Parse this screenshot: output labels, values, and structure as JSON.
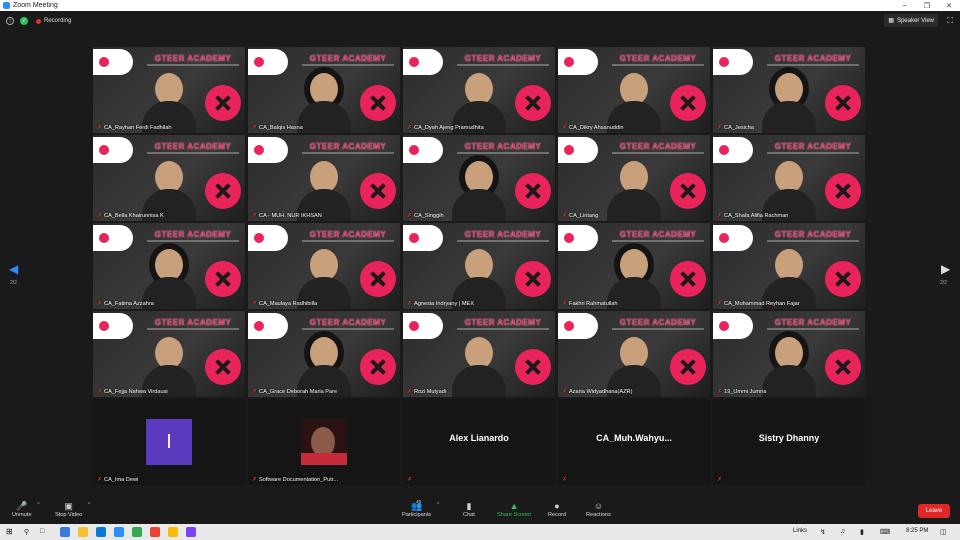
{
  "window": {
    "title": "Zoom Meeting"
  },
  "infobar": {
    "recording_label": "Recording",
    "speaker_view_label": "Speaker View"
  },
  "colors": {
    "brand": "#e8245b",
    "zoom_blue": "#2d8cff",
    "share_green": "#2fc35b",
    "leave_red": "#e02828"
  },
  "brand_text": "GTEER ACADEMY",
  "pagination": {
    "left_label": "2/2",
    "right_label": "2/2"
  },
  "participants": [
    {
      "name": "CA_Rayhan Ferdi Fadhilah",
      "type": "video",
      "muted": true
    },
    {
      "name": "CA_Balqis Hasna",
      "type": "video",
      "muted": true
    },
    {
      "name": "CA_Dyah Ajeng Pramudhita",
      "type": "video",
      "muted": true
    },
    {
      "name": "CA_Dikry Ahsanuddin",
      "type": "video",
      "muted": true
    },
    {
      "name": "CA_Jesicha",
      "type": "video",
      "muted": true
    },
    {
      "name": "CA_Bella Khairunnisa K",
      "type": "video",
      "muted": true
    },
    {
      "name": "CA - MUH. NUR IKHSAN",
      "type": "video",
      "muted": true
    },
    {
      "name": "CA_Singgih",
      "type": "video",
      "muted": true
    },
    {
      "name": "CA_Lintang",
      "type": "video",
      "muted": true
    },
    {
      "name": "CA_Shafa Alifia Rachman",
      "type": "video",
      "muted": true
    },
    {
      "name": "CA_Fatima Azzahra",
      "type": "video",
      "muted": true
    },
    {
      "name": "CA_Maulaya Radhibilla",
      "type": "video",
      "muted": true
    },
    {
      "name": "Agnesia Indryany | MEX",
      "type": "video",
      "muted": true
    },
    {
      "name": "Fakhri Rahmatullah",
      "type": "video",
      "muted": true
    },
    {
      "name": "CA_Muhammad Reyhan Fajar",
      "type": "video",
      "muted": true
    },
    {
      "name": "CA_Fejja Nahwa Virdausi",
      "type": "video",
      "muted": true
    },
    {
      "name": "CA_Grace Deborah Maria Pare",
      "type": "video",
      "muted": true
    },
    {
      "name": "Rozi Mulyadi",
      "type": "video",
      "muted": true
    },
    {
      "name": "Azaria Widyadhana(AZR)",
      "type": "video",
      "muted": true
    },
    {
      "name": "19_Ummi Jumria",
      "type": "video",
      "muted": true
    },
    {
      "name": "CA_Ima Dewi",
      "type": "avatar-initial",
      "initial": "I",
      "muted": true
    },
    {
      "name": "Software Documentation_Putr...",
      "type": "avatar-photo",
      "muted": true
    },
    {
      "name": "Alex Lianardo",
      "type": "name-only",
      "muted": true
    },
    {
      "name": "CA_Muh.Wahyu...",
      "type": "name-only",
      "muted": true
    },
    {
      "name": "Sistry Dhanny",
      "type": "name-only",
      "muted": true
    }
  ],
  "toolbar": {
    "unmute": "Unmute",
    "stop_video": "Stop Video",
    "participants": "Participants",
    "participants_count": "49",
    "chat": "Chat",
    "share_screen": "Share Screen",
    "record": "Record",
    "reactions": "Reactions",
    "leave": "Leave"
  },
  "taskbar": {
    "links_label": "Links",
    "clock": "8:25 PM"
  }
}
